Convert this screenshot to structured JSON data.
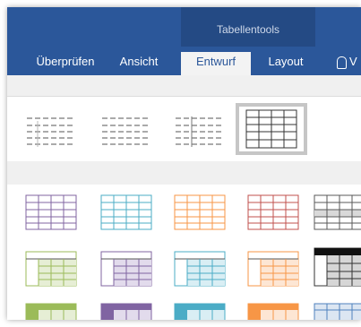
{
  "context_header": "Tabellentools",
  "tabs": [
    {
      "id": "ueberpruefen",
      "label": "Überprüfen"
    },
    {
      "id": "ansicht",
      "label": "Ansicht"
    },
    {
      "id": "entwurf",
      "label": "Entwurf"
    },
    {
      "id": "layout",
      "label": "Layout"
    }
  ],
  "tell_me": {
    "label": "V"
  },
  "colors": {
    "ribbon": "#2b579a",
    "context": "#244a84",
    "purple": "#8064a2",
    "blue": "#4bacc6",
    "orange": "#f79646",
    "red": "#c0504d",
    "gray": "#595959",
    "green": "#9bbb59",
    "lightblue": "#4f81bd"
  }
}
